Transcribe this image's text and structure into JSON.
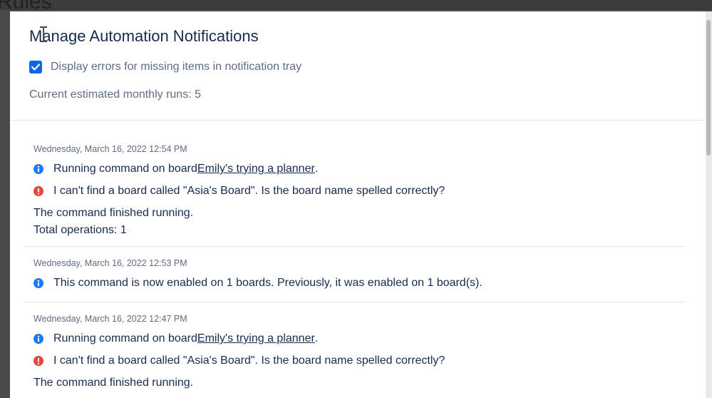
{
  "background": {
    "page_title": "Rules"
  },
  "modal": {
    "title": "Manage Automation Notifications",
    "checkbox_label": "Display errors for missing items in notification tray",
    "checkbox_checked": true,
    "runs_label": "Current estimated monthly runs: ",
    "runs_value": "5"
  },
  "entries": [
    {
      "timestamp": "Wednesday, March 16, 2022 12:54 PM",
      "info_prefix": "Running command on board ",
      "info_link": "Emily's trying a planner",
      "info_suffix": ".",
      "error": "I can't find a board called \"Asia's Board\". Is the board name spelled correctly?",
      "finished": "The command finished running.",
      "ops": "Total operations: 1"
    },
    {
      "timestamp": "Wednesday, March 16, 2022 12:53 PM",
      "info": "This command is now enabled on 1 boards. Previously, it was enabled on 1 board(s)."
    },
    {
      "timestamp": "Wednesday, March 16, 2022 12:47 PM",
      "info_prefix": "Running command on board ",
      "info_link": "Emily's trying a planner",
      "info_suffix": ".",
      "error": "I can't find a board called \"Asia's Board\". Is the board name spelled correctly?",
      "finished": "The command finished running."
    }
  ],
  "icons": {
    "info": "info-circle-icon",
    "error": "error-circle-icon",
    "check": "checkmark-icon",
    "cursor": "text-cursor-icon"
  },
  "colors": {
    "accent": "#0c66e4",
    "info": "#1d7afc",
    "error": "#e34935",
    "text": "#172b4d",
    "muted": "#5e6c84"
  }
}
